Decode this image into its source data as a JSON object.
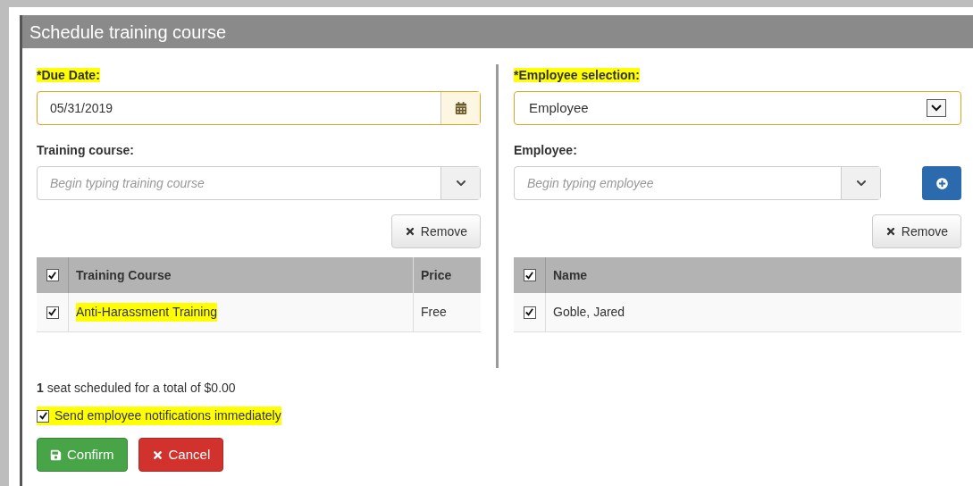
{
  "dialog": {
    "title": "Schedule training course"
  },
  "left": {
    "due_date": {
      "label": "*Due Date:",
      "highlighted": true,
      "value": "05/31/2019"
    },
    "course_field": {
      "label": "Training course:",
      "highlighted": false,
      "placeholder": "Begin typing training course"
    },
    "remove_button": "Remove",
    "table": {
      "columns": [
        {
          "label": "Training Course"
        },
        {
          "label": "Price"
        }
      ],
      "all_checked": true,
      "rows": [
        {
          "checked": true,
          "cells": [
            "Anti-Harassment Training",
            "Free"
          ],
          "highlighted": true
        }
      ]
    }
  },
  "right": {
    "selection": {
      "label": "*Employee selection:",
      "highlighted": true,
      "value": "Employee"
    },
    "employee_field": {
      "label": "Employee:",
      "highlighted": false,
      "placeholder": "Begin typing employee"
    },
    "remove_button": "Remove",
    "table": {
      "columns": [
        {
          "label": "Name"
        }
      ],
      "all_checked": true,
      "rows": [
        {
          "checked": true,
          "cells": [
            "Goble, Jared"
          ],
          "highlighted": false
        }
      ]
    }
  },
  "summary": "**1** seat scheduled for a total of $0.00",
  "notify": {
    "label": "Send employee notifications immediately",
    "checked": true,
    "highlighted": true
  },
  "buttons": [
    {
      "kind": "confirm",
      "label": "Confirm"
    },
    {
      "kind": "cancel",
      "label": "Cancel"
    }
  ]
}
